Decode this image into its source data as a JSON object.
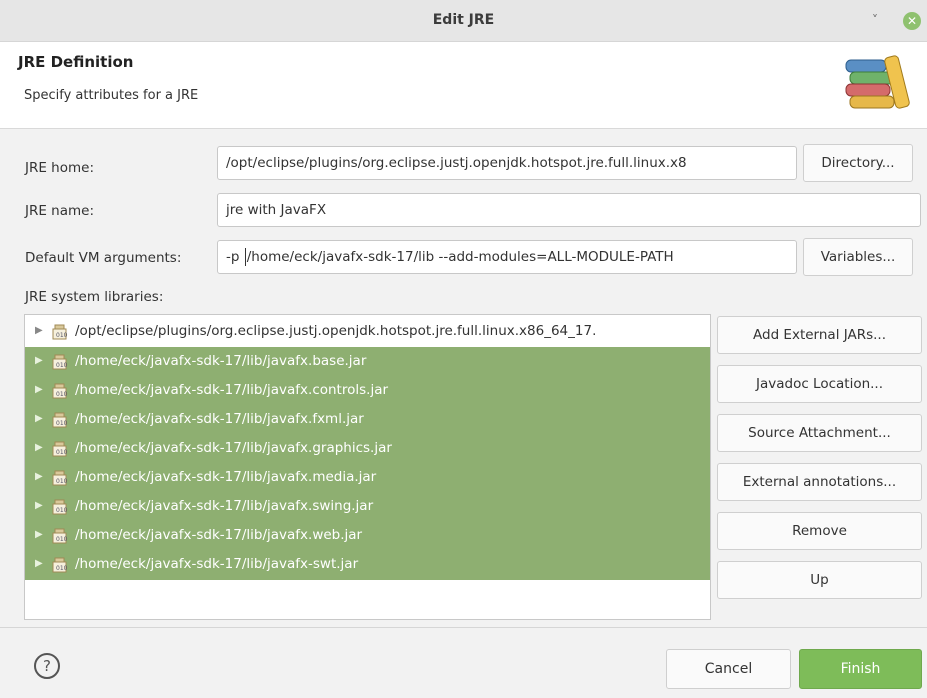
{
  "window": {
    "title": "Edit JRE",
    "close_glyph": "✕",
    "min_glyph": "˅"
  },
  "header": {
    "title": "JRE Definition",
    "subtitle": "Specify attributes for a JRE",
    "icon": "jre-books-icon"
  },
  "form": {
    "jre_home_label": "JRE home:",
    "jre_home_value": "/opt/eclipse/plugins/org.eclipse.justj.openjdk.hotspot.jre.full.linux.x8",
    "directory_button": "Directory...",
    "jre_name_label": "JRE name:",
    "jre_name_value": "jre with JavaFX",
    "vm_args_label": "Default VM arguments:",
    "vm_args_prefix": "-p ",
    "vm_args_rest": "/home/eck/javafx-sdk-17/lib  --add-modules=ALL-MODULE-PATH",
    "variables_button": "Variables...",
    "libraries_label": "JRE system libraries:"
  },
  "libraries": [
    {
      "path": "/opt/eclipse/plugins/org.eclipse.justj.openjdk.hotspot.jre.full.linux.x86_64_17.",
      "selected": false
    },
    {
      "path": "/home/eck/javafx-sdk-17/lib/javafx.base.jar",
      "selected": true
    },
    {
      "path": "/home/eck/javafx-sdk-17/lib/javafx.controls.jar",
      "selected": true
    },
    {
      "path": "/home/eck/javafx-sdk-17/lib/javafx.fxml.jar",
      "selected": true
    },
    {
      "path": "/home/eck/javafx-sdk-17/lib/javafx.graphics.jar",
      "selected": true
    },
    {
      "path": "/home/eck/javafx-sdk-17/lib/javafx.media.jar",
      "selected": true
    },
    {
      "path": "/home/eck/javafx-sdk-17/lib/javafx.swing.jar",
      "selected": true
    },
    {
      "path": "/home/eck/javafx-sdk-17/lib/javafx.web.jar",
      "selected": true
    },
    {
      "path": "/home/eck/javafx-sdk-17/lib/javafx-swt.jar",
      "selected": true
    }
  ],
  "side_buttons": {
    "add_external_jars": "Add External JARs...",
    "javadoc_location": "Javadoc Location...",
    "source_attachment": "Source Attachment...",
    "external_annotations": "External annotations...",
    "remove": "Remove",
    "up": "Up"
  },
  "footer": {
    "help_glyph": "?",
    "cancel": "Cancel",
    "finish": "Finish"
  },
  "colors": {
    "selection": "#8eaf71",
    "finish": "#7ebc59",
    "close": "#8fc16f"
  }
}
